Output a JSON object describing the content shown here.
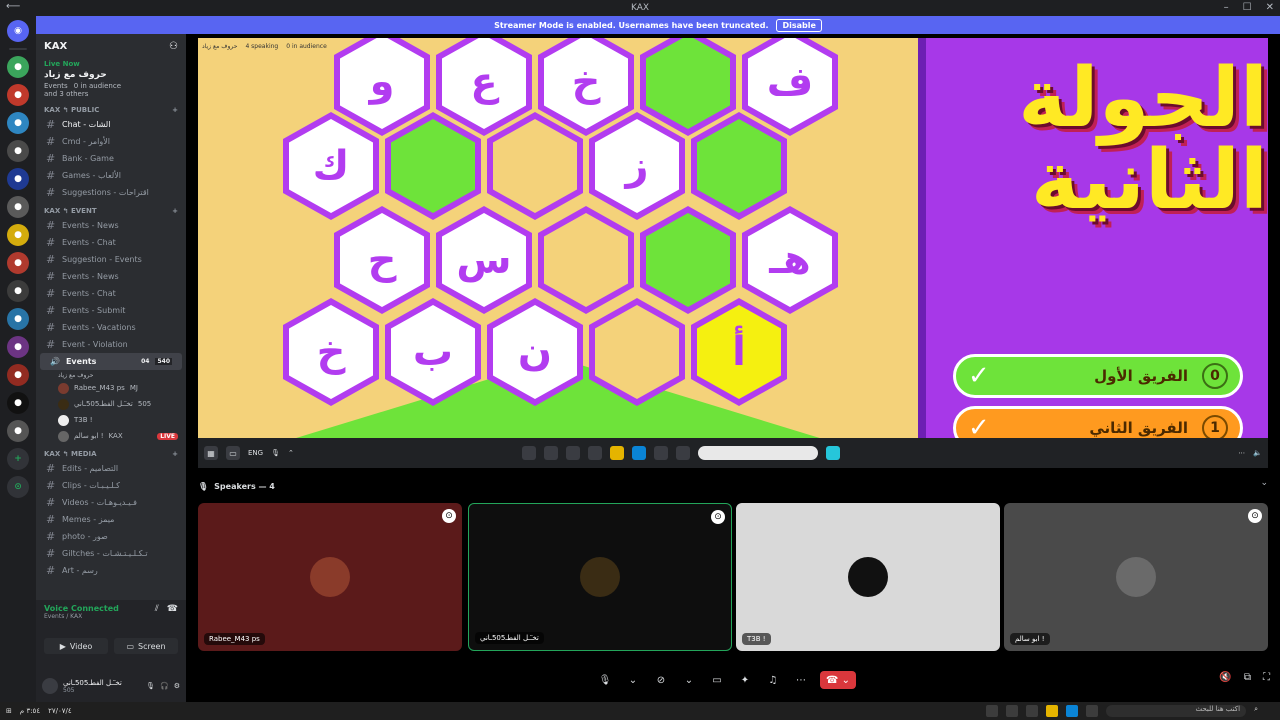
{
  "window": {
    "title": "KAX"
  },
  "banner": {
    "text": "Streamer Mode is enabled. Usernames have been truncated.",
    "button": "Disable"
  },
  "sidebar": {
    "guild_name": "KAX",
    "live": {
      "label": "Live Now",
      "title": "حروف مع زياد",
      "events": "Events",
      "audience": "0 in audience",
      "others": "and 3 others"
    },
    "categories": [
      {
        "name": "KAX ↰ PUBLIC",
        "channels": [
          {
            "label": "Chat - الشات",
            "active": true
          },
          {
            "label": "Cmd - الأوامر"
          },
          {
            "label": "Bank - Game"
          },
          {
            "label": "Games - الألعاب"
          },
          {
            "label": "Suggestions - اقتراحات"
          }
        ]
      },
      {
        "name": "KAX ↰ EVENT",
        "channels": [
          {
            "label": "Events - News"
          },
          {
            "label": "Events - Chat"
          },
          {
            "label": "Suggestion - Events"
          },
          {
            "label": "Events - News"
          },
          {
            "label": "Events - Chat"
          },
          {
            "label": "Events - Submit"
          },
          {
            "label": "Events - Vacations"
          },
          {
            "label": "Event - Violation"
          }
        ]
      }
    ],
    "voice_channel": {
      "label": "Events",
      "sub": "حروف مع زياد",
      "count_a": "04",
      "count_b": "540"
    },
    "voice_users": [
      {
        "name": "Rabee_M43 ps",
        "extra": "MJ"
      },
      {
        "name": "تخـٓـل الفطـ505ـاني",
        "extra": "505"
      },
      {
        "name": "T3B !",
        "extra": ""
      },
      {
        "name": "ابو سالم !",
        "extra": "KAX",
        "live": "LIVE"
      }
    ],
    "media_category": {
      "name": "KAX ↰ MEDIA",
      "channels": [
        {
          "label": "Edits - التصاميم"
        },
        {
          "label": "Clips - كـلـيـبـات"
        },
        {
          "label": "Videos - فـيـديـوهـات"
        },
        {
          "label": "Memes - ميمز"
        },
        {
          "label": "photo - صور"
        },
        {
          "label": "Giltches - تـكـلـيـتـشـات"
        },
        {
          "label": "Art - رسم"
        }
      ]
    },
    "voice_connected": {
      "title": "Voice Connected",
      "sub": "Events / KAX",
      "video": "Video",
      "screen": "Screen"
    },
    "user": {
      "name": "تخـٓـل الفطـ505ـاني",
      "status": "505"
    }
  },
  "stream": {
    "top_info": {
      "title": "حروف مع زياد",
      "speaking": "4 speaking",
      "audience": "0 in audience"
    },
    "round_title": "الجولة الثانية",
    "teams": [
      {
        "name": "الفريق الأول",
        "score": "0",
        "color": "#6ee33a"
      },
      {
        "name": "الفريق الثاني",
        "score": "1",
        "color": "#ff9a1f"
      }
    ],
    "hexes": [
      {
        "letter": "ف",
        "fill": "#ffffff"
      },
      {
        "letter": "",
        "fill": "#6ee33a"
      },
      {
        "letter": "خ",
        "fill": "#ffffff"
      },
      {
        "letter": "ع",
        "fill": "#ffffff"
      },
      {
        "letter": "و",
        "fill": "#ffffff"
      },
      {
        "letter": "",
        "fill": "#6ee33a"
      },
      {
        "letter": "ز",
        "fill": "#ffffff"
      },
      {
        "letter": "",
        "fill": "#f4d27a"
      },
      {
        "letter": "",
        "fill": "#6ee33a"
      },
      {
        "letter": "ك",
        "fill": "#ffffff"
      },
      {
        "letter": "هـ",
        "fill": "#ffffff"
      },
      {
        "letter": "",
        "fill": "#6ee33a"
      },
      {
        "letter": "",
        "fill": "#f4d27a"
      },
      {
        "letter": "س",
        "fill": "#ffffff"
      },
      {
        "letter": "ح",
        "fill": "#ffffff"
      },
      {
        "letter": "أ",
        "fill": "#f5f010"
      },
      {
        "letter": "",
        "fill": "#f4d27a"
      },
      {
        "letter": "ن",
        "fill": "#ffffff"
      },
      {
        "letter": "ب",
        "fill": "#ffffff"
      },
      {
        "letter": "خ",
        "fill": "#ffffff"
      }
    ],
    "toolbar": {
      "lang": "ENG"
    }
  },
  "speakers": {
    "header": "Speakers — 4",
    "tiles": [
      {
        "name": "Rabee_M43 ps",
        "bg": "#5b1a1a",
        "avatar": "#8a3b2a"
      },
      {
        "name": "تخـٓـل الفطـ505ـاني",
        "bg": "#0e0e0e",
        "avatar": "#3a2c14"
      },
      {
        "name": "T3B !",
        "bg": "#d9d9d9",
        "avatar": "#111111"
      },
      {
        "name": "ابو سالم !",
        "bg": "#4a4a4a",
        "avatar": "#6a6a6a"
      }
    ]
  },
  "taskbar": {
    "search": "اكتب هنا للبحث",
    "time": "٣:٥٤ م",
    "date": "٢٧/٠٧/٤"
  }
}
